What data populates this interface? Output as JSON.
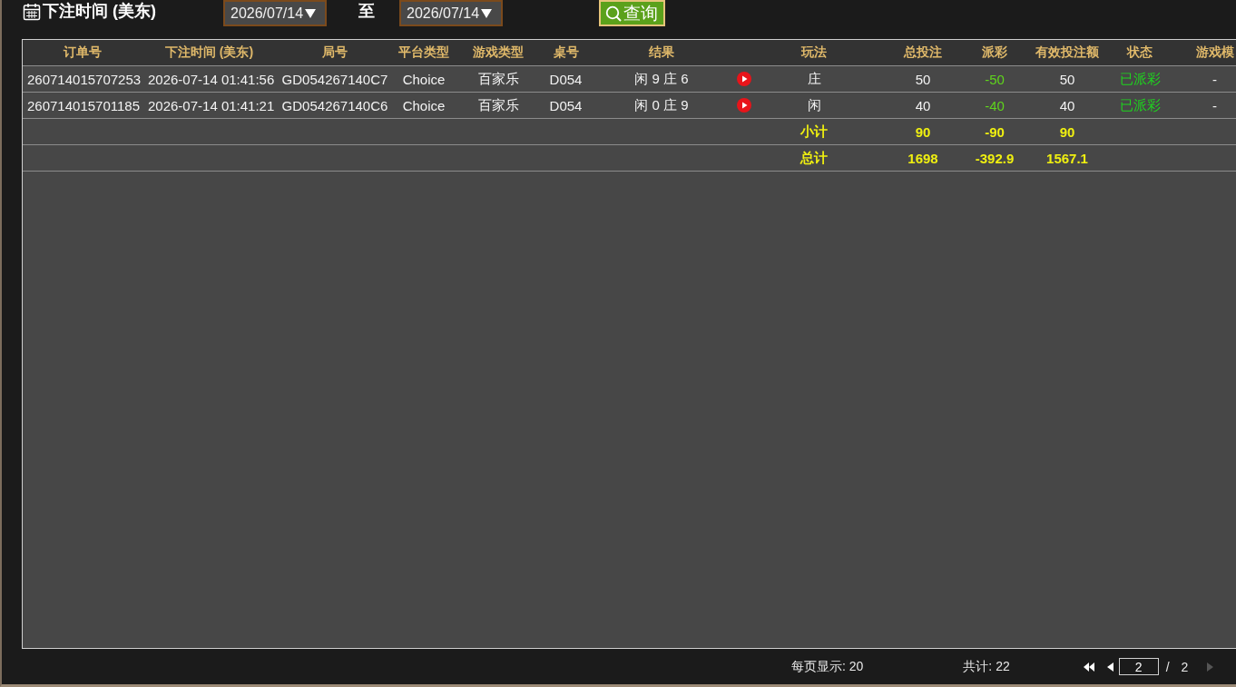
{
  "filter": {
    "label": "下注时间 (美东)",
    "start_date": {
      "value": "2026/07/14"
    },
    "range_separator": "至",
    "end_date": {
      "value": "2026/07/14"
    },
    "query_button": {
      "label": "查询"
    }
  },
  "table": {
    "columns": [
      "订单号",
      "下注时间 (美东)",
      "局号",
      "平台类型",
      "游戏类型",
      "桌号",
      "结果",
      "玩法",
      "总投注",
      "派彩",
      "有效投注额",
      "状态",
      "游戏模"
    ],
    "rows": [
      {
        "order_no": "260714015707253",
        "bet_time": "2026-07-14 01:41:56",
        "round_no": "GD054267140C7",
        "platform": "Choice",
        "game_type": "百家乐",
        "table_no": "D054",
        "result": "闲 9 庄 6",
        "replay": true,
        "bet_option": "庄",
        "total_bet": "50",
        "payout": "-50",
        "valid_bet": "50",
        "status": "已派彩",
        "game_mode": "-"
      },
      {
        "order_no": "260714015701185",
        "bet_time": "2026-07-14 01:41:21",
        "round_no": "GD054267140C6",
        "platform": "Choice",
        "game_type": "百家乐",
        "table_no": "D054",
        "result": "闲 0 庄 9",
        "replay": true,
        "bet_option": "闲",
        "total_bet": "40",
        "payout": "-40",
        "valid_bet": "40",
        "status": "已派彩",
        "game_mode": "-"
      }
    ],
    "summaries": [
      {
        "label": "小计",
        "total_bet": "90",
        "payout": "-90",
        "valid_bet": "90"
      },
      {
        "label": "总计",
        "total_bet": "1698",
        "payout": "-392.9",
        "valid_bet": "1567.1"
      }
    ]
  },
  "pagination": {
    "page_size": "每页显示: 20",
    "total": "共计: 22",
    "first_page": {
      "disabled": false
    },
    "prev_page": {
      "disabled": false
    },
    "page_input": {
      "value": "2"
    },
    "separator": "/",
    "page_count": "2",
    "next_page": {
      "disabled": true
    }
  }
}
